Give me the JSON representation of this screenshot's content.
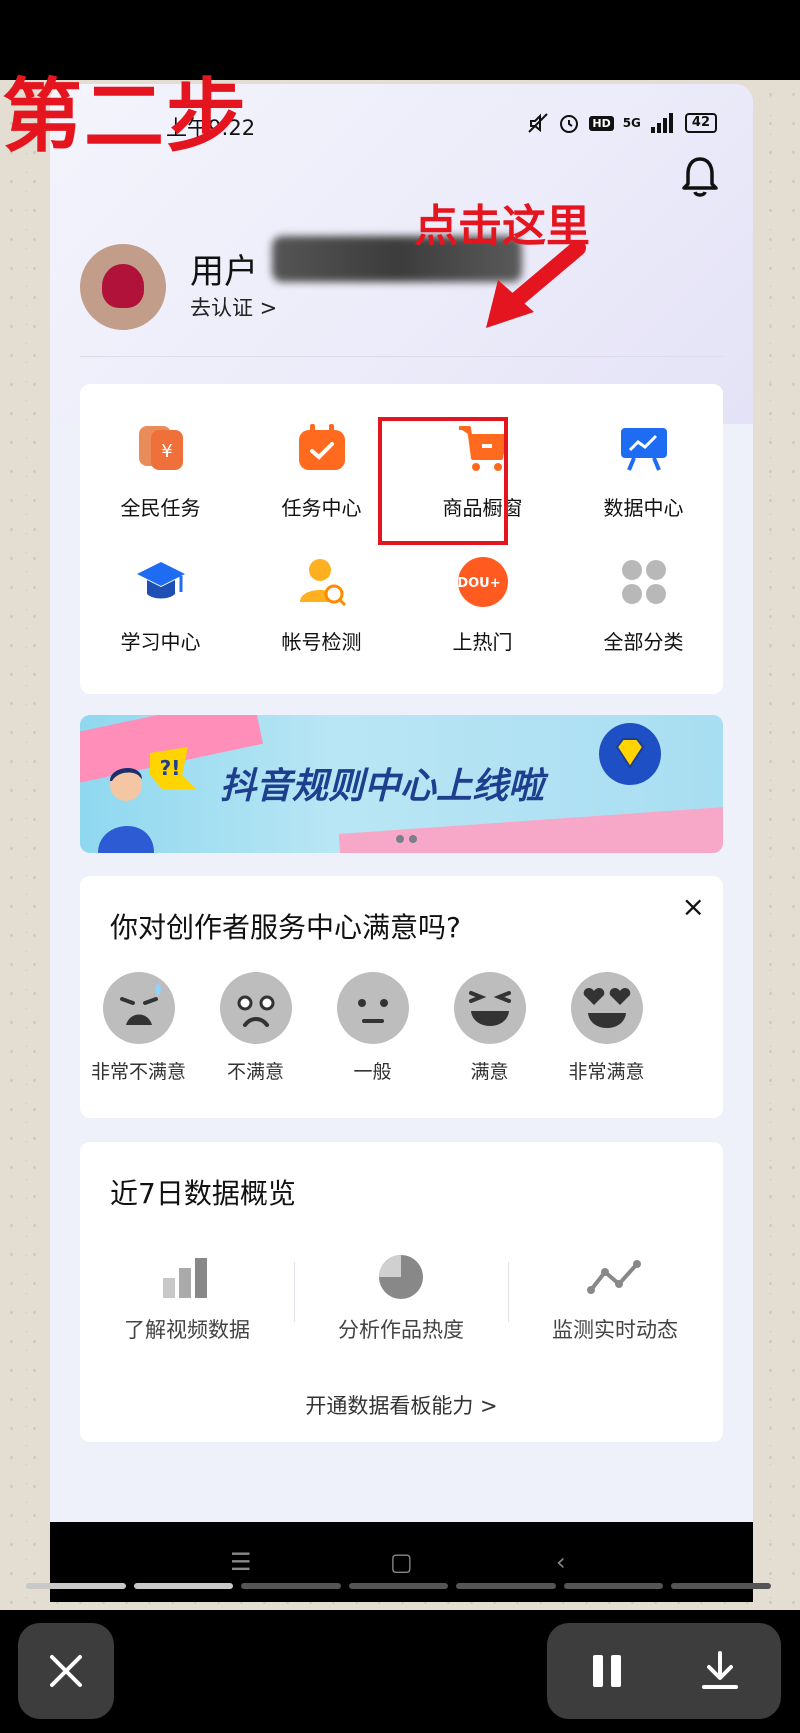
{
  "status_bar": {
    "time": "上午9:22",
    "network": "5G",
    "hd": "HD",
    "battery": "42"
  },
  "overlay": {
    "step_label": "第二步",
    "hint_label": "点击这里"
  },
  "profile": {
    "name": "用户",
    "verify_link": "去认证 >"
  },
  "shortcuts": [
    {
      "label": "全民任务",
      "icon": "task-coin-icon"
    },
    {
      "label": "任务中心",
      "icon": "task-center-icon"
    },
    {
      "label": "商品橱窗",
      "icon": "shopping-cart-icon",
      "highlighted": true
    },
    {
      "label": "数据中心",
      "icon": "data-board-icon"
    },
    {
      "label": "学习中心",
      "icon": "graduation-cap-icon"
    },
    {
      "label": "帐号检测",
      "icon": "account-check-icon"
    },
    {
      "label": "上热门",
      "icon": "dou-plus-icon",
      "badge": "DOU+"
    },
    {
      "label": "全部分类",
      "icon": "grid-dots-icon"
    }
  ],
  "banner": {
    "title": "抖音规则中心上线啦",
    "badge": "?!"
  },
  "survey": {
    "title": "你对创作者服务中心满意吗?",
    "close": "×",
    "options": [
      "非常不满意",
      "不满意",
      "一般",
      "满意",
      "非常满意"
    ]
  },
  "overview": {
    "title": "近7日数据概览",
    "items": [
      "了解视频数据",
      "分析作品热度",
      "监测实时动态"
    ],
    "link": "开通数据看板能力 >"
  },
  "colors": {
    "accent_red": "#e4151e",
    "orange": "#ff6a1f",
    "blue": "#1d6cf2",
    "navy_text": "#1e3f8e"
  },
  "player": {
    "close": "×",
    "segments_done": 2,
    "segments_total": 7
  }
}
